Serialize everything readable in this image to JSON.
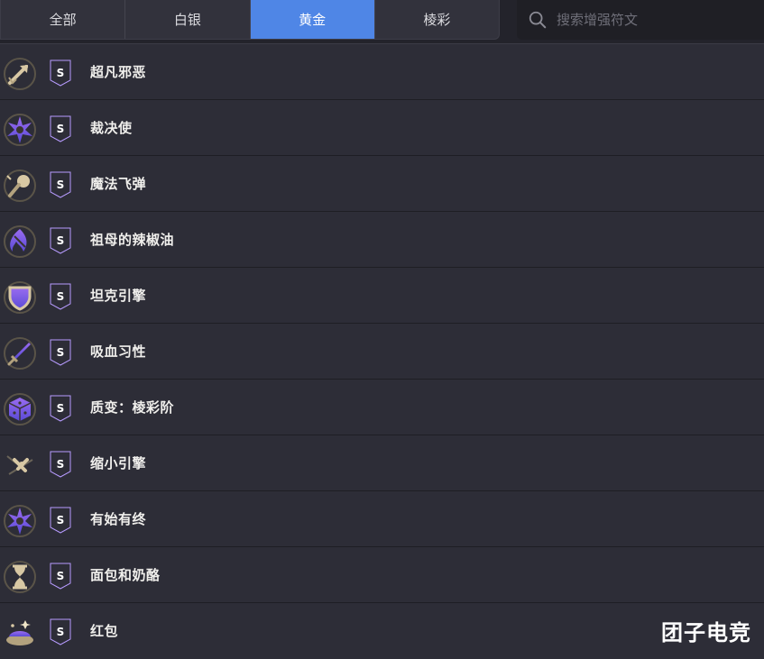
{
  "tabs": [
    {
      "label": "全部",
      "active": false
    },
    {
      "label": "白银",
      "active": false
    },
    {
      "label": "黄金",
      "active": true
    },
    {
      "label": "棱彩",
      "active": false
    }
  ],
  "search": {
    "placeholder": "搜索增强符文",
    "value": ""
  },
  "tier_badge": {
    "letter": "S",
    "color_top": "#9a6cf0",
    "color_bottom": "#5a4bd6"
  },
  "augments": [
    {
      "name": "超凡邪恶",
      "icon": "arrow-up-icon"
    },
    {
      "name": "裁决使",
      "icon": "burst-icon"
    },
    {
      "name": "魔法飞弹",
      "icon": "missile-icon"
    },
    {
      "name": "祖母的辣椒油",
      "icon": "flame-icon"
    },
    {
      "name": "坦克引擎",
      "icon": "shield-icon"
    },
    {
      "name": "吸血习性",
      "icon": "sword-icon"
    },
    {
      "name": "质变：棱彩阶",
      "icon": "dice-icon"
    },
    {
      "name": "缩小引擎",
      "icon": "shrink-icon"
    },
    {
      "name": "有始有终",
      "icon": "burst-icon"
    },
    {
      "name": "面包和奶酪",
      "icon": "hourglass-icon"
    },
    {
      "name": "红包",
      "icon": "gift-icon"
    }
  ],
  "watermark": "团子电竞",
  "colors": {
    "accent": "#4f86e6",
    "background": "#2d2d37",
    "icon_gold": "#d8c8a4"
  }
}
